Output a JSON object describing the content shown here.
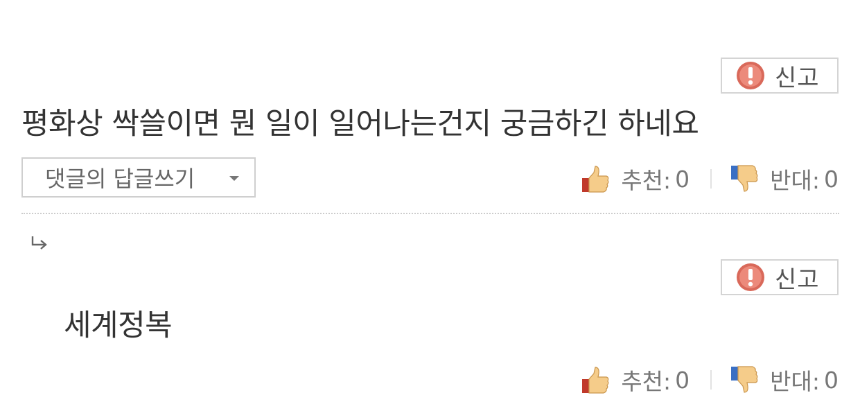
{
  "comments": [
    {
      "report_label": "신고",
      "text": "평화상 싹쓸이면 뭔 일이 일어나는건지 궁금하긴 하네요",
      "reply_toggle_label": "댓글의 답글쓰기",
      "upvote_label": "추천:",
      "upvote_count": "0",
      "downvote_label": "반대:",
      "downvote_count": "0"
    },
    {
      "report_label": "신고",
      "text": "세계정복",
      "upvote_label": "추천:",
      "upvote_count": "0",
      "downvote_label": "반대:",
      "downvote_count": "0"
    }
  ],
  "reply_arrow_glyph": "↳",
  "icons": {
    "report": "warning-icon",
    "upvote": "thumbs-up-icon",
    "downvote": "thumbs-down-icon",
    "reply_toggle": "caret-down-icon"
  },
  "colors": {
    "report_icon": "#e07060",
    "thumb_up_cuff": "#c0392b",
    "thumb_down_cuff": "#3a6fc4",
    "thumb_skin": "#f5cc8a"
  }
}
